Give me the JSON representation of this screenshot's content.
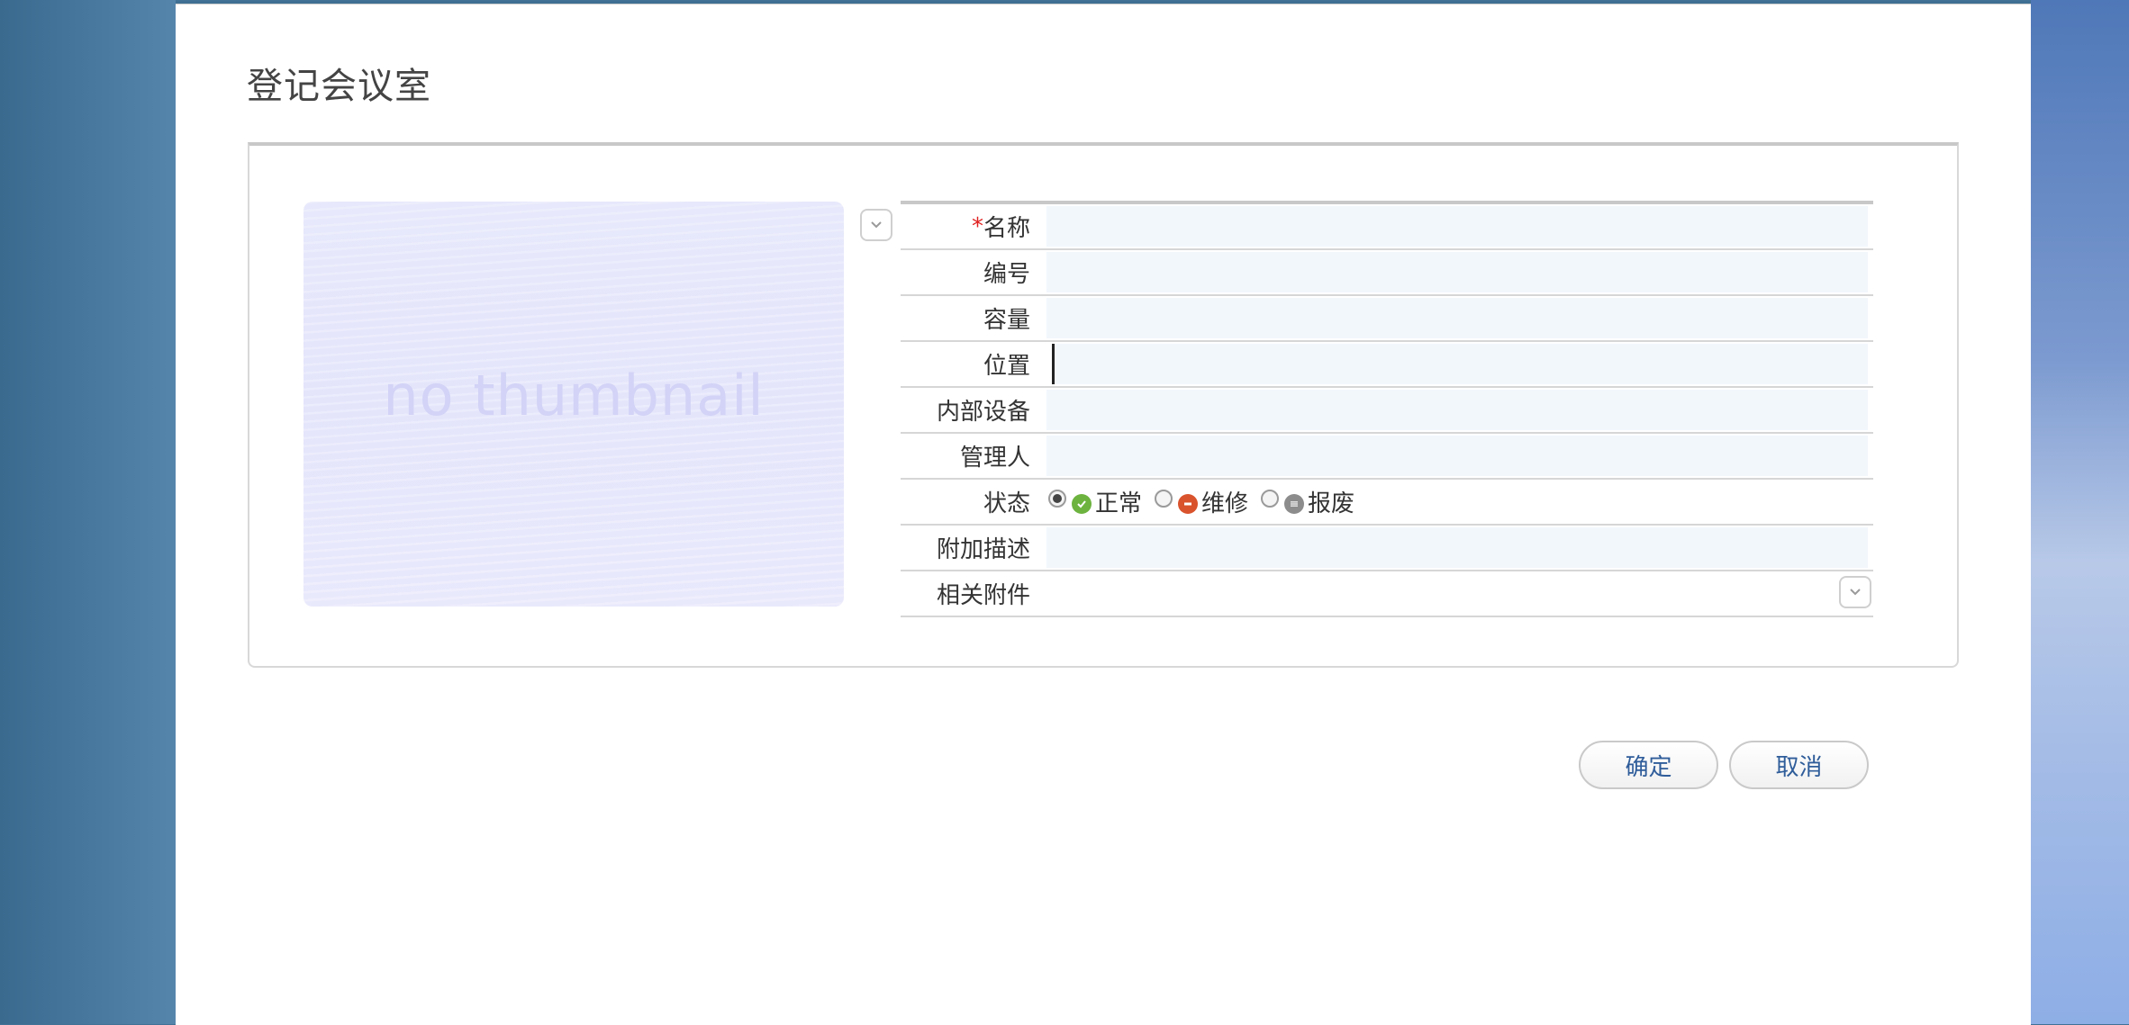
{
  "dialog": {
    "title": "登记会议室"
  },
  "thumbnail": {
    "text": "no thumbnail"
  },
  "form": {
    "fields": [
      {
        "label": "名称",
        "required": true,
        "value": ""
      },
      {
        "label": "编号",
        "value": ""
      },
      {
        "label": "容量",
        "value": ""
      },
      {
        "label": "位置",
        "value": "",
        "focused": true
      },
      {
        "label": "内部设备",
        "value": ""
      },
      {
        "label": "管理人",
        "value": ""
      }
    ],
    "required_mark": "*",
    "status": {
      "label": "状态",
      "options": [
        {
          "label": "正常",
          "selected": true,
          "icon": "check-icon",
          "color": "#6db33f"
        },
        {
          "label": "维修",
          "selected": false,
          "icon": "no-entry-icon",
          "color": "#d9532c"
        },
        {
          "label": "报废",
          "selected": false,
          "icon": "disabled-icon",
          "color": "#8c8c8c"
        }
      ]
    },
    "description": {
      "label": "附加描述",
      "value": ""
    },
    "attachments": {
      "label": "相关附件"
    }
  },
  "buttons": {
    "confirm": "确定",
    "cancel": "取消"
  }
}
